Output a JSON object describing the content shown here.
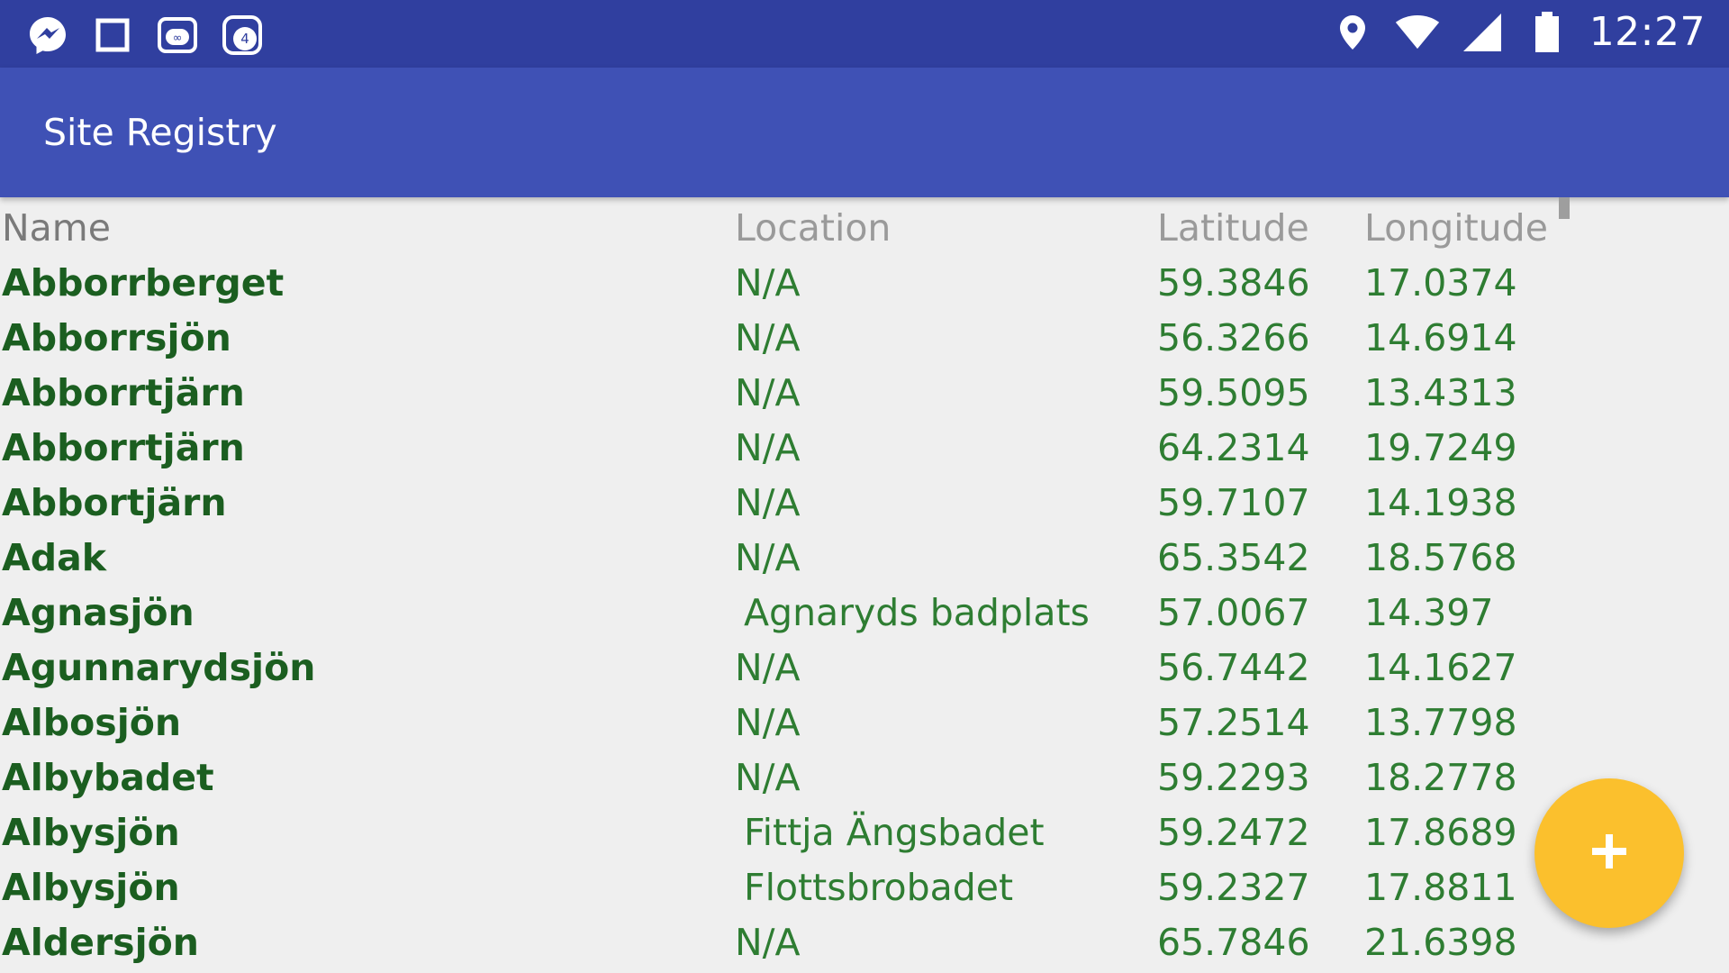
{
  "status_bar": {
    "clock": "12:27",
    "left_icons": [
      "messenger-icon",
      "square-icon",
      "owl-app-icon",
      "notification-count-icon"
    ],
    "notification_count": "4",
    "right_icons": [
      "location-pin-icon",
      "wifi-icon",
      "cell-signal-icon",
      "battery-icon"
    ]
  },
  "app_bar": {
    "title": "Site Registry"
  },
  "table": {
    "headers": {
      "name": "Name",
      "location": "Location",
      "latitude": "Latitude",
      "longitude": "Longitude"
    },
    "rows": [
      {
        "name": "Abborrberget",
        "location": "N/A",
        "latitude": "59.3846",
        "longitude": "17.0374"
      },
      {
        "name": "Abborrsjön",
        "location": "N/A",
        "latitude": "56.3266",
        "longitude": "14.6914"
      },
      {
        "name": "Abborrtjärn",
        "location": "N/A",
        "latitude": "59.5095",
        "longitude": "13.4313"
      },
      {
        "name": "Abborrtjärn",
        "location": "N/A",
        "latitude": "64.2314",
        "longitude": "19.7249"
      },
      {
        "name": "Abbortjärn",
        "location": "N/A",
        "latitude": "59.7107",
        "longitude": "14.1938"
      },
      {
        "name": "Adak",
        "location": "N/A",
        "latitude": "65.3542",
        "longitude": "18.5768"
      },
      {
        "name": "Agnasjön",
        "location": "Agnaryds badplats",
        "latitude": "57.0067",
        "longitude": "14.397"
      },
      {
        "name": "Agunnarydsjön",
        "location": "N/A",
        "latitude": "56.7442",
        "longitude": "14.1627"
      },
      {
        "name": "Albosjön",
        "location": "N/A",
        "latitude": "57.2514",
        "longitude": "13.7798"
      },
      {
        "name": "Albybadet",
        "location": "N/A",
        "latitude": "59.2293",
        "longitude": "18.2778"
      },
      {
        "name": "Albysjön",
        "location": "Fittja Ängsbadet",
        "latitude": "59.2472",
        "longitude": "17.8689"
      },
      {
        "name": "Albysjön",
        "location": "Flottsbrobadet",
        "latitude": "59.2327",
        "longitude": "17.8811"
      },
      {
        "name": "Aldersjön",
        "location": "N/A",
        "latitude": "65.7846",
        "longitude": "21.6398"
      }
    ]
  },
  "fab": {
    "icon": "plus-icon"
  },
  "colors": {
    "status_bar": "#303f9f",
    "app_bar": "#3f51b5",
    "row_text": "#2e7d32",
    "name_text": "#1b5e20",
    "fab": "#fbc02d"
  }
}
